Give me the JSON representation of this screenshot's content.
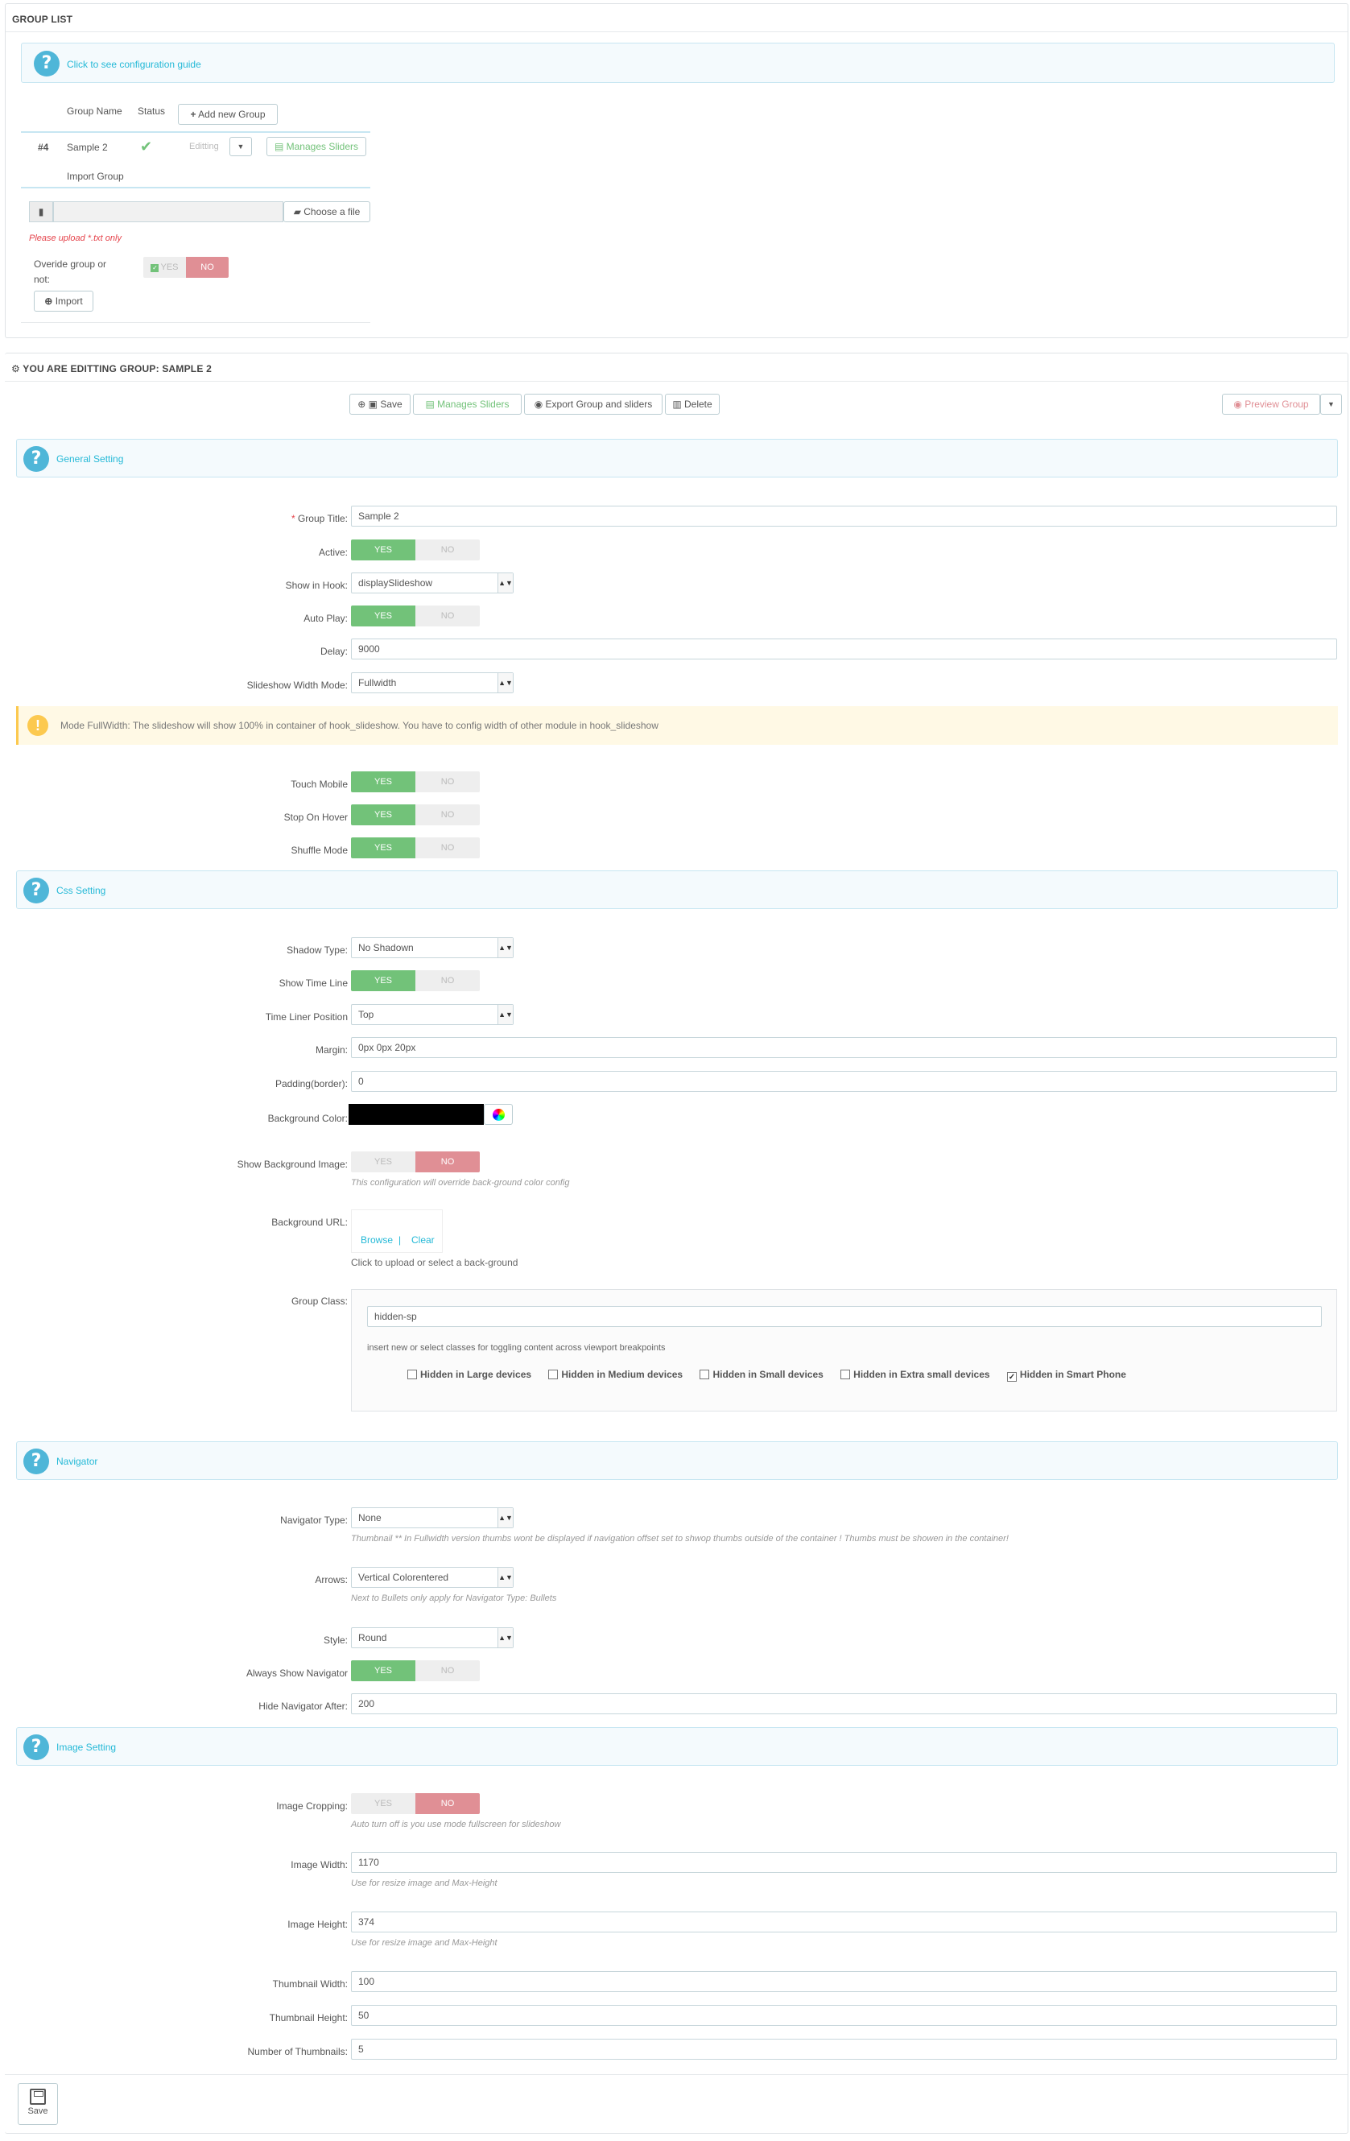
{
  "group_list": {
    "title": "GROUP LIST",
    "guide_link": "Click to see configuration guide",
    "col_group_name": "Group Name",
    "col_status": "Status",
    "add_new_group": "Add new Group",
    "row": {
      "id": "#4",
      "name": "Sample 2",
      "status_icon": "check-icon",
      "editing": "Editting",
      "manage": "Manages Sliders"
    },
    "import_title": "Import Group",
    "choose_file": "Choose a file",
    "upload_hint": "Please upload *.txt only",
    "override_label_1": "Overide group or",
    "override_label_2": "not:",
    "yes": "YES",
    "no": "NO",
    "import_btn": "Import"
  },
  "editing": {
    "title": "YOU ARE EDITTING GROUP: SAMPLE 2",
    "toolbar": {
      "save": "Save",
      "manage": "Manages Sliders",
      "export": "Export Group and sliders",
      "delete": "Delete",
      "preview": "Preview Group"
    }
  },
  "general": {
    "header": "General Setting",
    "group_title_label": "Group Title:",
    "group_title": "Sample 2",
    "active_label": "Active:",
    "hook_label": "Show in Hook:",
    "hook": "displaySlideshow",
    "autoplay_label": "Auto Play:",
    "delay_label": "Delay:",
    "delay": "9000",
    "width_mode_label": "Slideshow Width Mode:",
    "width_mode": "Fullwidth",
    "warning": "Mode FullWidth: The slideshow will show 100% in container of hook_slideshow. You have to config width of other module in hook_slideshow",
    "touch_label": "Touch Mobile",
    "stop_hover_label": "Stop On Hover",
    "shuffle_label": "Shuffle Mode"
  },
  "css": {
    "header": "Css Setting",
    "shadow_label": "Shadow Type:",
    "shadow": "No Shadown",
    "timeline_label": "Show Time Line",
    "timeline_pos_label": "Time Liner Position",
    "timeline_pos": "Top",
    "margin_label": "Margin:",
    "margin": "0px 0px 20px",
    "padding_label": "Padding(border):",
    "padding": "0",
    "bg_color_label": "Background Color:",
    "bg_color": "#000000",
    "show_bg_label": "Show Background Image:",
    "show_bg_help": "This configuration will override back-ground color config",
    "bg_url_label": "Background URL:",
    "browse": "Browse",
    "sep": "|",
    "clear": "Clear",
    "bg_url_help": "Click to upload or select a back-ground",
    "group_class_label": "Group Class:",
    "group_class": "hidden-sp",
    "group_class_help": "insert new or select classes for toggling content across viewport breakpoints",
    "checkboxes": [
      {
        "label": "Hidden in Large devices",
        "checked": false
      },
      {
        "label": "Hidden in Medium devices",
        "checked": false
      },
      {
        "label": "Hidden in Small devices",
        "checked": false
      },
      {
        "label": "Hidden in Extra small devices",
        "checked": false
      },
      {
        "label": "Hidden in Smart Phone",
        "checked": true
      }
    ]
  },
  "navigator": {
    "header": "Navigator",
    "type_label": "Navigator Type:",
    "type": "None",
    "type_help": "Thumbnail ** In Fullwidth version thumbs wont be displayed if navigation offset set to shwop thumbs outside of the container ! Thumbs must be showen in the container!",
    "arrows_label": "Arrows:",
    "arrows": "Vertical Colorentered",
    "arrows_help": "Next to Bullets only apply for Navigator Type: Bullets",
    "style_label": "Style:",
    "style": "Round",
    "always_label": "Always Show Navigator",
    "hide_after_label": "Hide Navigator After:",
    "hide_after": "200"
  },
  "image": {
    "header": "Image Setting",
    "crop_label": "Image Cropping:",
    "crop_help": "Auto turn off is you use mode fullscreen for slideshow",
    "width_label": "Image Width:",
    "width": "1170",
    "width_help": "Use for resize image and Max-Height",
    "height_label": "Image Height:",
    "height": "374",
    "height_help": "Use for resize image and Max-Height",
    "thumb_w_label": "Thumbnail Width:",
    "thumb_w": "100",
    "thumb_h_label": "Thumbnail Height:",
    "thumb_h": "50",
    "num_thumb_label": "Number of Thumbnails:",
    "num_thumb": "5"
  },
  "footer": {
    "save": "Save"
  }
}
